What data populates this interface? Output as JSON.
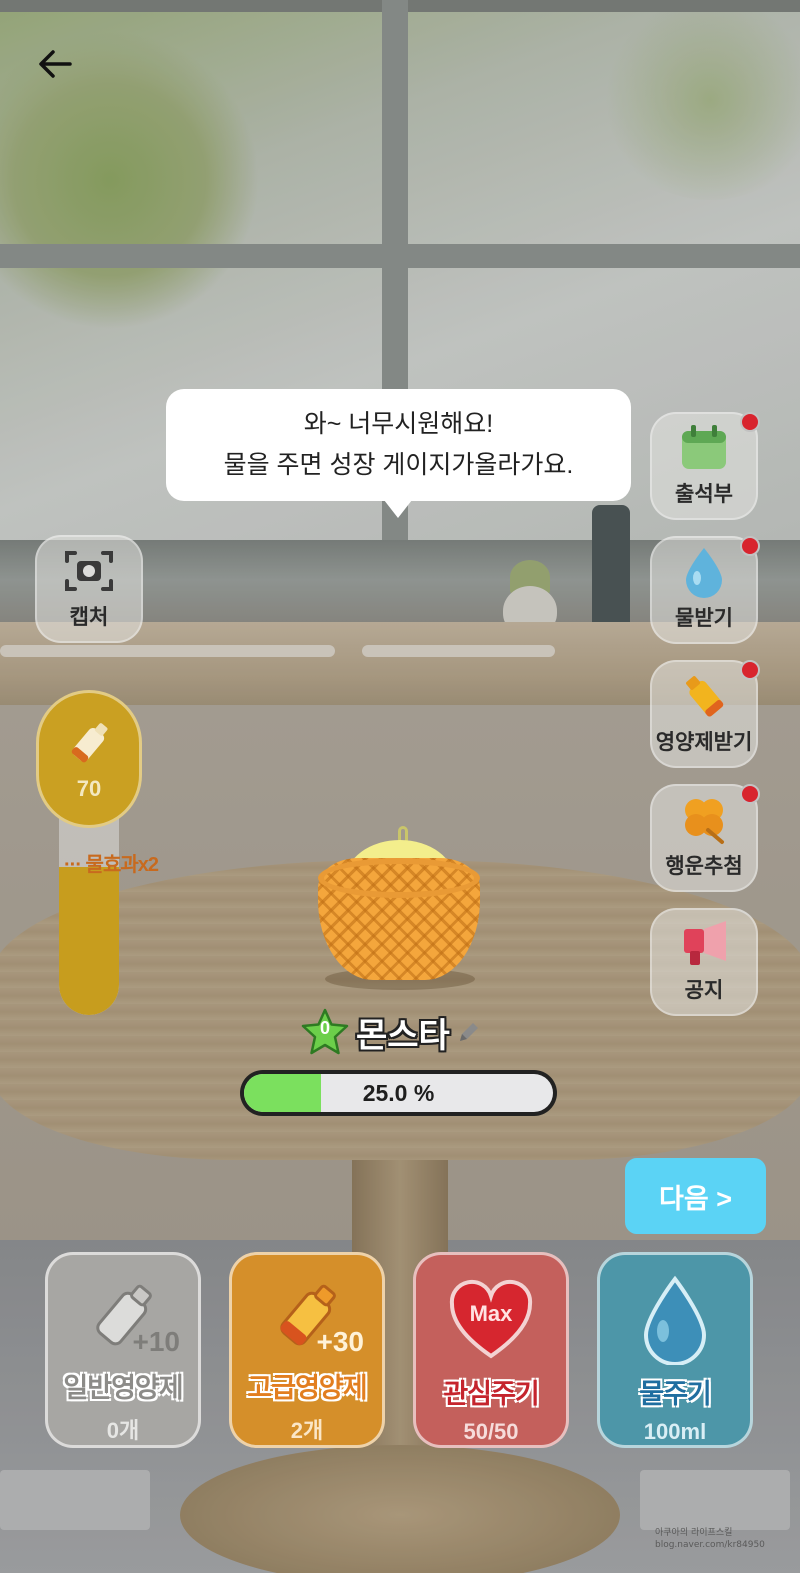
{
  "topbar": {
    "back_icon": "arrow-left-icon"
  },
  "bubble": {
    "line1": "와~ 너무시원해요!",
    "line2": "물을 주면 성장 게이지가올라가요."
  },
  "capture": {
    "label": "캡처",
    "icon": "camera-icon"
  },
  "side_menu": [
    {
      "label": "출석부",
      "icon": "calendar-icon",
      "notification": true,
      "accent": "#7dc96a"
    },
    {
      "label": "물받기",
      "icon": "water-drop-icon",
      "notification": true,
      "accent": "#5bb6e6"
    },
    {
      "label": "영양제받기",
      "icon": "nutrient-bottle-icon",
      "notification": true,
      "accent": "#f2b41e"
    },
    {
      "label": "행운추첨",
      "icon": "clover-icon",
      "notification": true,
      "accent": "#f0a021"
    },
    {
      "label": "공지",
      "icon": "megaphone-icon",
      "notification": false,
      "accent": "#e0425a"
    }
  ],
  "gauge": {
    "value": "70",
    "level_fraction": 0.72,
    "marker": "물효과x2"
  },
  "pet": {
    "level": "0",
    "name": "몬스타",
    "progress_text": "25.0 %",
    "progress_fraction": 0.25
  },
  "next_button": {
    "label": "다음 >"
  },
  "actions": [
    {
      "title": "일반영양제",
      "sub": "0개",
      "plus": "+10",
      "icon": "bottle-icon",
      "bg": "#a7a6a3",
      "fg": "#8c8b88"
    },
    {
      "title": "고급영양제",
      "sub": "2개",
      "plus": "+30",
      "icon": "premium-bottle-icon",
      "bg": "#d58f2a",
      "fg": "#e27e1f"
    },
    {
      "title": "관심주기",
      "sub": "50/50",
      "badge": "Max",
      "icon": "heart-icon",
      "bg": "#c4605c",
      "fg": "#c5242d"
    },
    {
      "title": "물주기",
      "sub": "100ml",
      "icon": "water-drop-icon",
      "bg": "#4d96a8",
      "fg": "#1f6ea0"
    }
  ],
  "colors": {
    "progress_fill": "#7be05e",
    "next_button": "#5bd3f5",
    "notification": "#d8242e",
    "gauge": "#caa022"
  },
  "watermark": {
    "line1": "아쿠아의 라이프스킬",
    "line2": "blog.naver.com/kr84950"
  }
}
